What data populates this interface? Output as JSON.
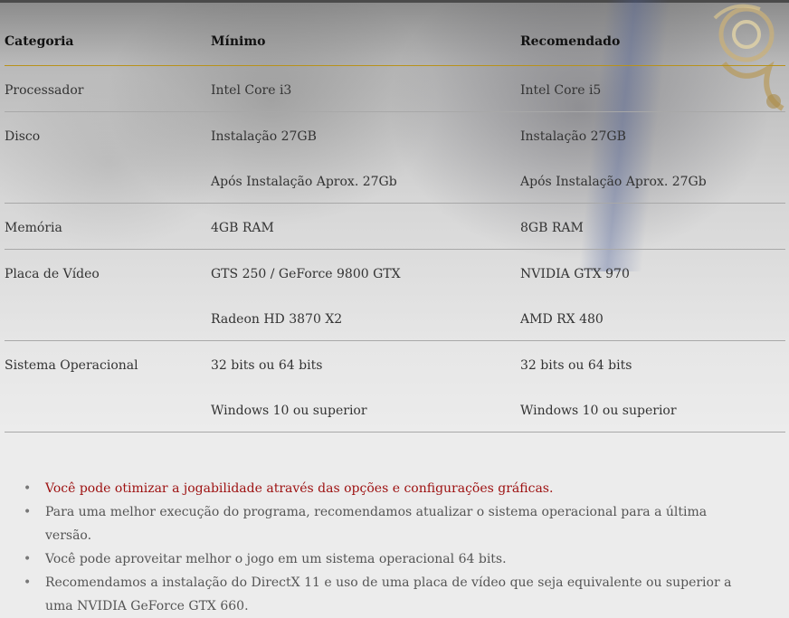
{
  "table": {
    "headers": [
      "Categoria",
      "Mínimo",
      "Recomendado"
    ],
    "rows": [
      {
        "category": "Processador",
        "minimum": [
          "Intel Core i3"
        ],
        "recommended": [
          "Intel Core i5"
        ]
      },
      {
        "category": "Disco",
        "minimum": [
          "Instalação 27GB",
          "Após Instalação Aprox. 27Gb"
        ],
        "recommended": [
          "Instalação 27GB",
          "Após Instalação Aprox. 27Gb"
        ]
      },
      {
        "category": "Memória",
        "minimum": [
          "4GB RAM"
        ],
        "recommended": [
          "8GB RAM"
        ]
      },
      {
        "category": "Placa de Vídeo",
        "minimum": [
          "GTS 250 / GeForce 9800 GTX",
          "Radeon HD 3870 X2"
        ],
        "recommended": [
          "NVIDIA GTX 970",
          "AMD RX 480"
        ]
      },
      {
        "category": "Sistema Operacional",
        "minimum": [
          "32 bits ou 64 bits",
          "Windows 10 ou superior"
        ],
        "recommended": [
          "32 bits ou 64 bits",
          "Windows 10 ou superior"
        ]
      }
    ]
  },
  "notes": [
    {
      "text": "Você pode otimizar a jogabilidade através das opções e configurações gráficas.",
      "highlight": true
    },
    {
      "text": "Para uma melhor execução do programa, recomendamos atualizar o sistema operacional para a última versão.",
      "highlight": false
    },
    {
      "text": "Você pode aproveitar melhor o jogo em um sistema operacional 64 bits.",
      "highlight": false
    },
    {
      "text": "Recomendamos a instalação do DirectX 11 e uso de uma placa de vídeo que seja equivalente ou superior a uma NVIDIA GeForce GTX 660.",
      "highlight": false
    }
  ],
  "colors": {
    "header_rule": "#b8921a",
    "row_rule": "#a8a8a8",
    "highlight_text": "#9d1010",
    "body_text": "#333333"
  },
  "icons": {
    "bullet": "bullet-dot-icon",
    "ornament": "gold-ornament-icon"
  }
}
